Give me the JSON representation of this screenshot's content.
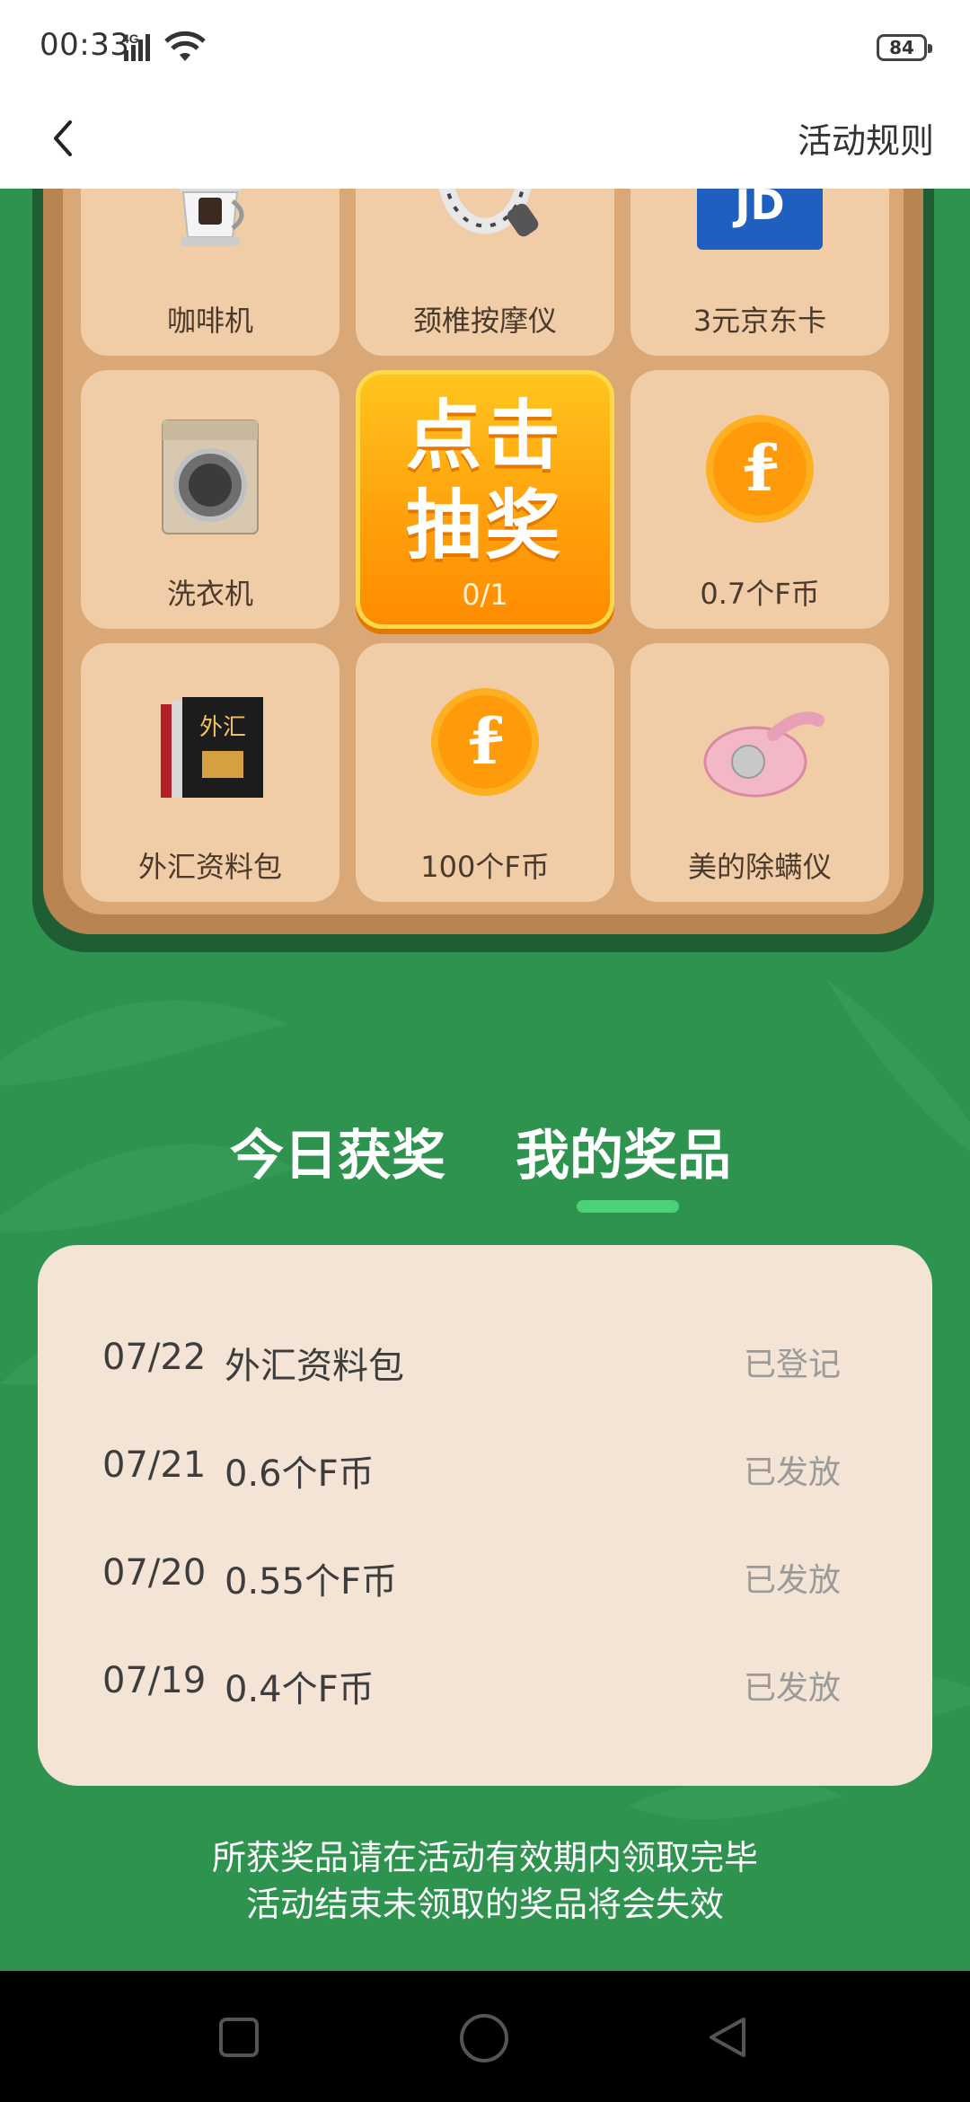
{
  "status_bar": {
    "time": "00:33",
    "network": "4G",
    "battery": "84"
  },
  "nav": {
    "rules_label": "活动规则"
  },
  "board": {
    "cells": [
      {
        "label": "咖啡机",
        "icon": "coffee-machine-icon"
      },
      {
        "label": "颈椎按摩仪",
        "icon": "neck-massager-icon"
      },
      {
        "label": "3元京东卡",
        "icon": "jd-card-icon"
      },
      {
        "label": "洗衣机",
        "icon": "washing-machine-icon"
      },
      {
        "label": "0.7个F币",
        "icon": "f-coin-icon"
      },
      {
        "label": "外汇资料包",
        "icon": "book-pack-icon"
      },
      {
        "label": "100个F币",
        "icon": "f-coin-icon"
      },
      {
        "label": "美的除螨仪",
        "icon": "mite-remover-icon"
      }
    ],
    "draw_button": {
      "title": "点击抽奖",
      "count": "0/1"
    }
  },
  "tabs": [
    {
      "label": "今日获奖",
      "active": false
    },
    {
      "label": "我的奖品",
      "active": true
    }
  ],
  "prizes": [
    {
      "date": "07/22",
      "name": "外汇资料包",
      "status": "已登记"
    },
    {
      "date": "07/21",
      "name": "0.6个F币",
      "status": "已发放"
    },
    {
      "date": "07/20",
      "name": "0.55个F币",
      "status": "已发放"
    },
    {
      "date": "07/19",
      "name": "0.4个F币",
      "status": "已发放"
    }
  ],
  "footer": {
    "line1": "所获奖品请在活动有效期内领取完毕",
    "line2": "活动结束未领取的奖品将会失效"
  },
  "colors": {
    "background": "#2e934f",
    "tab_indicator": "#4cd07a",
    "panel": "#f3e4d6"
  }
}
